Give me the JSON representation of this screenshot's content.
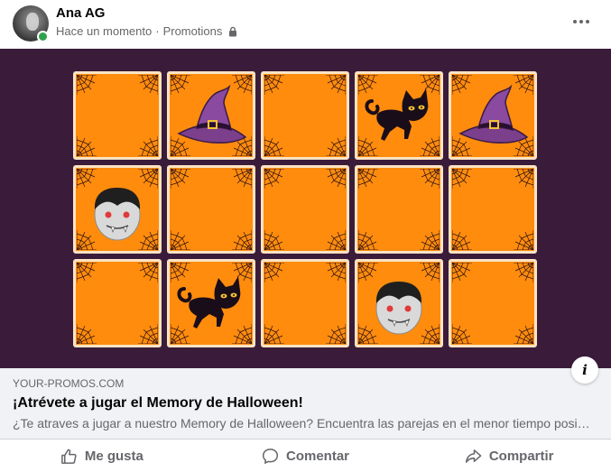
{
  "post": {
    "author": "Ana AG",
    "timestamp": "Hace un momento",
    "separator": "·",
    "audience": "Promotions",
    "audience_icon": "lock-icon",
    "more_icon": "more-options-icon"
  },
  "game": {
    "colors": {
      "background": "#3a1c3a",
      "card": "#ff8c0d",
      "card_border": "#fbe3c4"
    },
    "rows": [
      [
        "blank",
        "witch-hat",
        "blank",
        "black-cat",
        "witch-hat"
      ],
      [
        "vampire",
        "blank",
        "blank",
        "blank",
        "blank"
      ],
      [
        "blank",
        "black-cat",
        "blank",
        "vampire",
        "blank"
      ]
    ]
  },
  "link": {
    "domain": "YOUR-PROMOS.COM",
    "title": "¡Atrévete a jugar el Memory de Halloween!",
    "description": "¿Te atraves a jugar a nuestro Memory de Halloween? Encuentra las parejas en el menor tiempo posible",
    "info_label": "i"
  },
  "actions": {
    "like": "Me gusta",
    "comment": "Comentar",
    "share": "Compartir"
  }
}
